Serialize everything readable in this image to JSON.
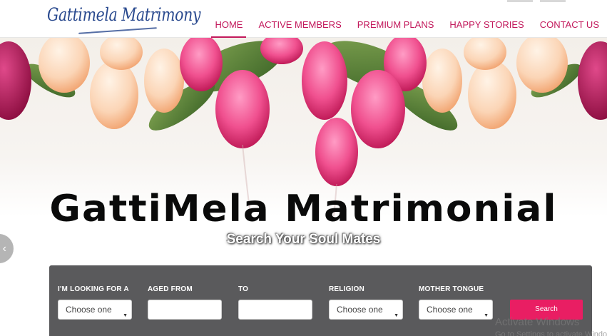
{
  "header": {
    "logo": "Gattimela Matrimony",
    "nav": [
      {
        "label": "HOME",
        "active": true
      },
      {
        "label": "ACTIVE MEMBERS",
        "active": false
      },
      {
        "label": "PREMIUM PLANS",
        "active": false
      },
      {
        "label": "HAPPY STORIES",
        "active": false
      },
      {
        "label": "CONTACT US",
        "active": false
      }
    ]
  },
  "hero": {
    "title": "GattiMela Matrimonial",
    "subtitle": "Search Your Soul Mates",
    "prev_icon": "chevron-left-icon",
    "prev_glyph": "‹"
  },
  "search": {
    "fields": [
      {
        "label": "I'M LOOKING FOR A",
        "type": "select",
        "value": "Choose one"
      },
      {
        "label": "AGED FROM",
        "type": "input",
        "value": ""
      },
      {
        "label": "TO",
        "type": "input",
        "value": ""
      },
      {
        "label": "RELIGION",
        "type": "select",
        "value": "Choose one"
      },
      {
        "label": "MOTHER TONGUE",
        "type": "select",
        "value": "Choose one"
      }
    ],
    "button_label": "Search",
    "arrow_glyph": "▼"
  },
  "watermark": {
    "title": "Activate Windows",
    "subtitle": "Go to Settings to activate Windows."
  },
  "colors": {
    "accent": "#c2185b",
    "button": "#e91e63",
    "panel": "#5a5a5c",
    "logo": "#2a4a8f"
  }
}
